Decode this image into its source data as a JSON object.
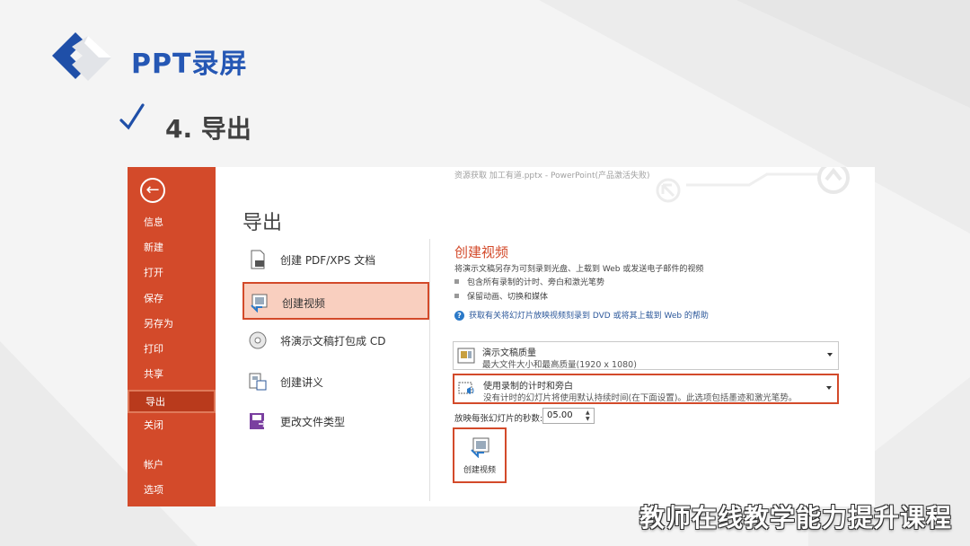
{
  "slide": {
    "title": "PPT录屏",
    "subtitle": "4. 导出"
  },
  "window": {
    "titlebar": "资源获取 加工有道.pptx - PowerPoint(产品激活失败)"
  },
  "nav": {
    "back": "←",
    "items": [
      {
        "label": "信息"
      },
      {
        "label": "新建"
      },
      {
        "label": "打开"
      },
      {
        "label": "保存"
      },
      {
        "label": "另存为"
      },
      {
        "label": "打印"
      },
      {
        "label": "共享"
      },
      {
        "label": "导出",
        "active": true
      },
      {
        "label": "关闭"
      },
      {
        "label": "帐户"
      },
      {
        "label": "选项"
      }
    ]
  },
  "export": {
    "heading": "导出",
    "options": [
      {
        "label": "创建 PDF/XPS 文档",
        "icon": "pdf-doc-icon"
      },
      {
        "label": "创建视频",
        "icon": "video-icon",
        "selected": true
      },
      {
        "label": "将演示文稿打包成 CD",
        "icon": "cd-icon"
      },
      {
        "label": "创建讲义",
        "icon": "handout-icon"
      },
      {
        "label": "更改文件类型",
        "icon": "change-type-icon"
      }
    ]
  },
  "video": {
    "title": "创建视频",
    "description": "将演示文稿另存为可刻录到光盘、上载到 Web 或发送电子邮件的视频",
    "bullets": [
      "包含所有录制的计时、旁白和激光笔势",
      "保留动画、切换和媒体"
    ],
    "help_link": "获取有关将幻灯片放映视频刻录到 DVD 或将其上载到 Web 的帮助",
    "quality": {
      "title": "演示文稿质量",
      "detail": "最大文件大小和最高质量(1920 x 1080)"
    },
    "timing": {
      "title": "使用录制的计时和旁白",
      "detail": "没有计时的幻灯片将使用默认持续时间(在下面设置)。此选项包括墨迹和激光笔势。"
    },
    "seconds_label": "放映每张幻灯片的秒数:",
    "seconds_value": "05.00",
    "create_button": "创建视频"
  },
  "watermark": "教师在线教学能力提升课程",
  "colors": {
    "accent": "#d34a2a",
    "title_blue": "#2557b4",
    "nav_active": "#b93a1c"
  }
}
